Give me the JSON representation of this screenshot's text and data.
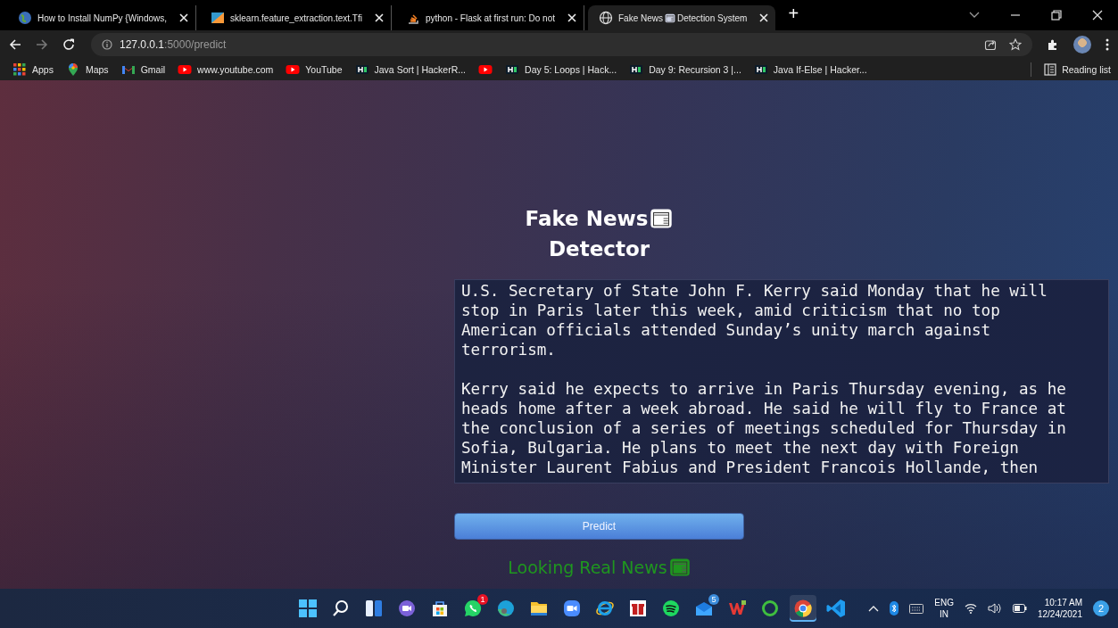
{
  "browser": {
    "tabs": [
      {
        "kind": "globe-blue",
        "title": "How to Install NumPy {Windows,",
        "selected": false
      },
      {
        "kind": "sklearn",
        "title": "sklearn.feature_extraction.text.Tfi",
        "selected": false
      },
      {
        "kind": "stack",
        "title": "python - Flask at first run: Do not",
        "selected": false
      },
      {
        "kind": "globe",
        "title": "Fake News",
        "title_after": "Detection System",
        "selected": true
      }
    ],
    "new_tab": "+",
    "address": {
      "host": "127.0.0.1",
      "path": ":5000/predict"
    },
    "bookmarks": [
      {
        "kind": "apps",
        "label": "Apps"
      },
      {
        "kind": "maps",
        "label": "Maps"
      },
      {
        "kind": "gmail",
        "label": "Gmail"
      },
      {
        "kind": "youtube",
        "label": "www.youtube.com"
      },
      {
        "kind": "youtube",
        "label": "YouTube"
      },
      {
        "kind": "hackerrank",
        "label": "Java Sort | HackerR..."
      },
      {
        "kind": "youtube"
      },
      {
        "kind": "hackerrank",
        "label": "Day 5: Loops | Hack..."
      },
      {
        "kind": "hackerrank",
        "label": "Day 9: Recursion 3 |..."
      },
      {
        "kind": "hackerrank",
        "label": "Java If-Else | Hacker..."
      }
    ],
    "reading_list": "Reading list"
  },
  "page": {
    "title_line_1": "Fake News",
    "title_line_2": "Detector",
    "article": "U.S. Secretary of State John F. Kerry said Monday that he will stop in Paris later this week, amid criticism that no top American officials attended Sunday’s unity march against terrorism.\n\nKerry said he expects to arrive in Paris Thursday evening, as he heads home after a week abroad. He said he will fly to France at the conclusion of a series of meetings scheduled for Thursday in Sofia, Bulgaria. He plans to meet the next day with Foreign Minister Laurent Fabius and President Francois Hollande, then",
    "button": "Predict",
    "result": {
      "text": "Looking Real News"
    }
  },
  "taskbar": {
    "apps": [
      {
        "kind": "start",
        "selected": false
      },
      {
        "kind": "search",
        "selected": false
      },
      {
        "kind": "widgets",
        "selected": false
      },
      {
        "kind": "chat",
        "selected": false
      },
      {
        "kind": "store",
        "selected": false
      },
      {
        "kind": "whatsapp",
        "badge": "1",
        "selected": false
      },
      {
        "kind": "edge",
        "selected": false
      },
      {
        "kind": "folder",
        "selected": false
      },
      {
        "kind": "zoom",
        "selected": false
      },
      {
        "kind": "ie",
        "selected": false
      },
      {
        "kind": "gift",
        "selected": false
      },
      {
        "kind": "spotify",
        "selected": false
      },
      {
        "kind": "mail",
        "badge": "5",
        "selected": false
      },
      {
        "kind": "wps",
        "selected": false
      },
      {
        "kind": "ring",
        "selected": false
      },
      {
        "kind": "chrome",
        "selected": true
      },
      {
        "kind": "vscode",
        "selected": false
      }
    ],
    "language": "ENG",
    "region": "IN",
    "time": "10:17 AM",
    "date": "12/24/2021",
    "notifications": "2"
  }
}
